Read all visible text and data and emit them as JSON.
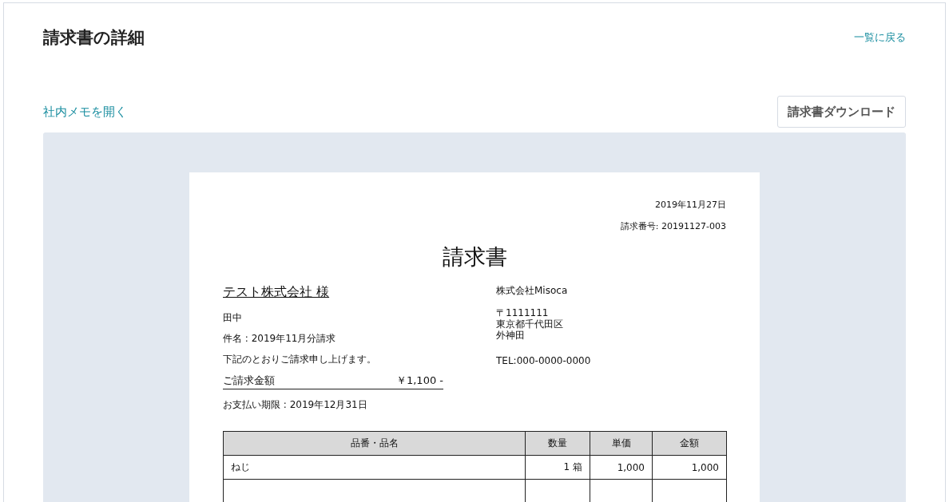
{
  "page": {
    "title": "請求書の詳細",
    "back_link": "一覧に戻る",
    "memo_link": "社内メモを開く",
    "download_button": "請求書ダウンロード"
  },
  "invoice": {
    "date": "2019年11月27日",
    "number": "請求番号: 20191127-003",
    "heading": "請求書",
    "recipient": "テスト株式会社 様",
    "contact": "田中",
    "subject": "件名 : 2019年11月分請求",
    "message": "下記のとおりご請求申し上げます。",
    "amount_label": "ご請求金額",
    "amount": "￥1,100 -",
    "due": "お支払い期限 : 2019年12月31日",
    "issuer": {
      "name": "株式会社Misoca",
      "address": [
        "〒1111111",
        "東京都千代田区",
        "外神田"
      ],
      "tel": "TEL:000-0000-0000"
    },
    "table": {
      "columns": [
        "品番・品名",
        "数量",
        "単価",
        "金額"
      ],
      "rows": [
        [
          "ねじ",
          "1 箱",
          "1,000",
          "1,000"
        ]
      ]
    }
  }
}
